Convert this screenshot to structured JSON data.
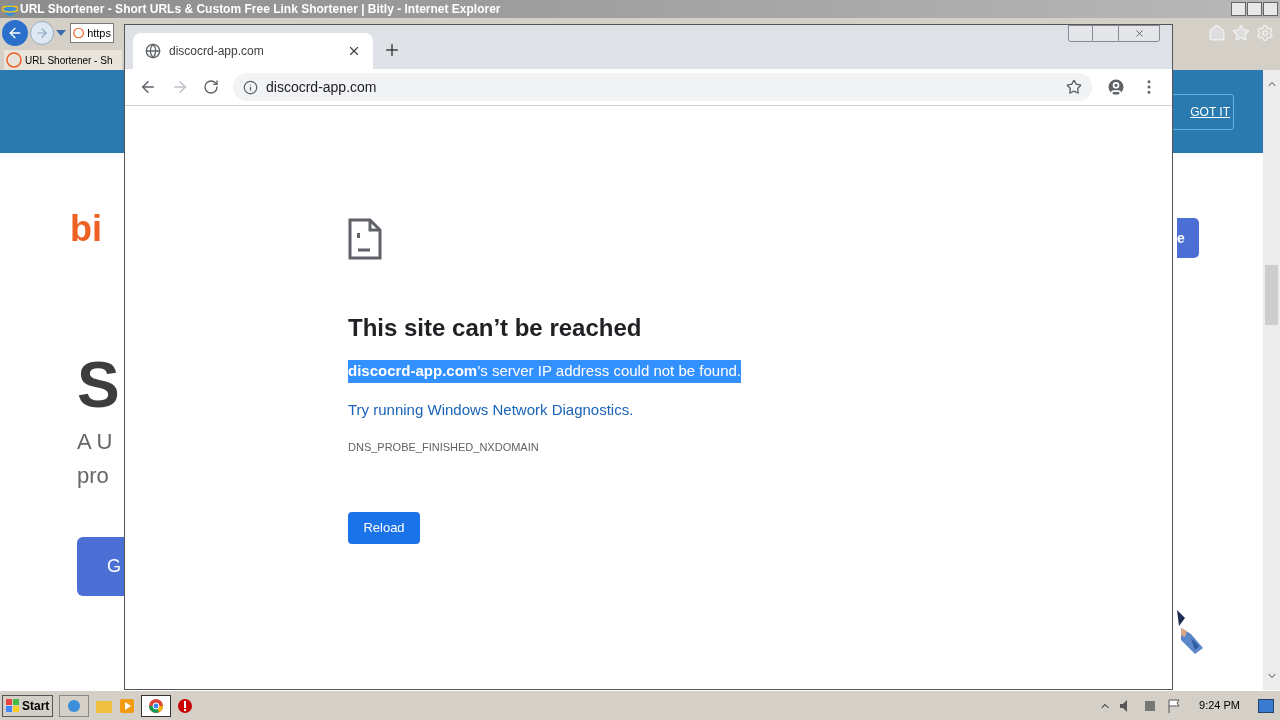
{
  "ie_window": {
    "title": "URL Shortener - Short URLs & Custom Free Link Shortener | Bitly - Internet Explorer",
    "address": "https",
    "tab": {
      "label": "URL Shortener - Sh",
      "selected": true
    },
    "banner_button": "GOT IT",
    "page": {
      "logo": "bi",
      "heading": "S",
      "subtitle_lines": [
        "A U",
        "pro"
      ],
      "left_button": "G",
      "right_button": "e"
    }
  },
  "chrome_window": {
    "tab": {
      "title": "discocrd-app.com",
      "selected": true
    },
    "url": "discocrd-app.com",
    "error": {
      "heading": "This site can’t be reached",
      "message": {
        "text": "**discocrd-app.com**’s server IP address could not be found.",
        "selected": true
      },
      "link": "Try running Windows Network Diagnostics.",
      "code": "DNS_PROBE_FINISHED_NXDOMAIN",
      "button": "Reload"
    }
  },
  "taskbar": {
    "start": "Start",
    "clock": "9:24 PM"
  }
}
